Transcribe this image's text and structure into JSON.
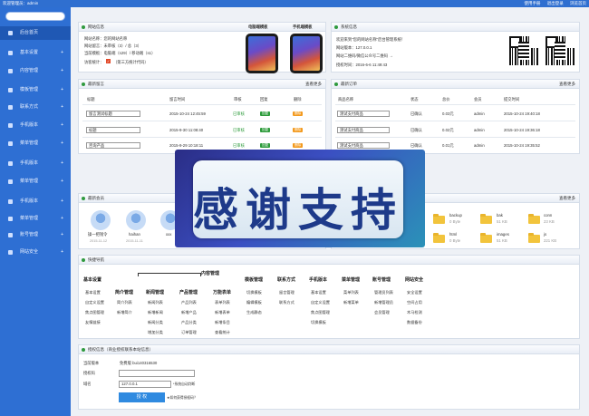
{
  "topbar": {
    "title": "欢迎管理员：admin",
    "links": [
      "使用手册",
      "退出登录",
      "浏览首页"
    ]
  },
  "sidebar": {
    "items": [
      {
        "label": "后台首页",
        "plus": ""
      },
      {
        "label": "基本设置",
        "plus": "+"
      },
      {
        "label": "内容管理",
        "plus": "+"
      },
      {
        "label": "模板管理",
        "plus": "+"
      },
      {
        "label": "联系方式",
        "plus": "+"
      },
      {
        "label": "手机版本",
        "plus": "+"
      },
      {
        "label": "菜单管理",
        "plus": "+"
      },
      {
        "label": "手机版本",
        "plus": "+"
      },
      {
        "label": "菜单管理",
        "plus": "+"
      },
      {
        "label": "手机版本",
        "plus": "+"
      },
      {
        "label": "菜单管理",
        "plus": "+"
      },
      {
        "label": "账号管理",
        "plus": "+"
      },
      {
        "label": "网站安全",
        "plus": "+"
      }
    ]
  },
  "site_info": {
    "title": "网站信息",
    "lines": [
      "网站名称：您的网站名称",
      "网站留言：未审核（3）/ 总（3）",
      "当前模板：电脑端（s29）/ 移动端（s1）",
      "访客统计：",
      "（第三方统计代码）"
    ],
    "pc_label": "电脑端模板",
    "mobile_label": "手机端模板",
    "ok": "✓"
  },
  "sys_info": {
    "title": "系统信息",
    "lines": [
      "欢迎来到\"您的网站名称\"后台管理系统！",
      "网站版本：127.0.0.1",
      "网站二维码/微信公众号二维码 →",
      "授权时间：2016-6-6 11:49:43"
    ]
  },
  "messages": {
    "title": "最新留言",
    "more": "查看更多",
    "headers": [
      "标题",
      "留言时间",
      "审核",
      "回复",
      "删除"
    ],
    "rows": [
      {
        "title": "留言测试标题",
        "time": "2015-10-24 12:45:59",
        "status": "已审核",
        "reply": "回复",
        "del": "删除"
      },
      {
        "title": "标题",
        "time": "2015-9-30 11:08:40",
        "status": "已审核",
        "reply": "回复",
        "del": "删除"
      },
      {
        "title": "咨询产品",
        "time": "2015-9-29 10:18:11",
        "status": "已审核",
        "reply": "回复",
        "del": "删除"
      }
    ]
  },
  "orders": {
    "title": "最新订单",
    "more": "查看更多",
    "headers": [
      "商品名称",
      "状态",
      "总价",
      "会员",
      "提交时间"
    ],
    "rows": [
      {
        "name": "测试支付商品",
        "status": "已确认",
        "price": "0.03元",
        "member": "admin",
        "time": "2015-10-24 19:40:18"
      },
      {
        "name": "测试支付商品",
        "status": "已确认",
        "price": "0.02元",
        "member": "admin",
        "time": "2015-10-24 19:36:18"
      },
      {
        "name": "测试支付商品",
        "status": "已确认",
        "price": "0.01元",
        "member": "admin",
        "time": "2015-10-24 19:35:52"
      }
    ]
  },
  "members": {
    "title": "最新会员",
    "more": "查看更多",
    "list": [
      {
        "name": "操一把钱令",
        "date": "2015-11-12"
      },
      {
        "name": "haihan",
        "date": "2015-11-11"
      },
      {
        "name": "xxx",
        "date": ""
      }
    ]
  },
  "files": {
    "more": "查看更多",
    "list": [
      {
        "name": "backup",
        "size": "0 Byte"
      },
      {
        "name": "bak",
        "size": "51 KB"
      },
      {
        "name": "conn",
        "size": "23 KB"
      },
      {
        "name": "html",
        "size": "0 Byte"
      },
      {
        "name": "images",
        "size": "51 KB"
      },
      {
        "name": "js",
        "size": "221 KB"
      }
    ]
  },
  "nav": {
    "title": "快捷导航",
    "content_mgmt": "内容管理",
    "groups": [
      {
        "title": "基本设置",
        "items": [
          "基本设置",
          "自定义设置",
          "焦点图管理",
          "友情链接"
        ]
      },
      {
        "title": "简介管理",
        "items": [
          "简介列表",
          "新增简介"
        ]
      },
      {
        "title": "新闻管理",
        "items": [
          "新闻列表",
          "新增新闻",
          "新闻分类",
          "增加分类"
        ]
      },
      {
        "title": "产品管理",
        "items": [
          "产品列表",
          "新增产品",
          "产品分类",
          "订单管理"
        ]
      },
      {
        "title": "万能表单",
        "items": [
          "表单列表",
          "新增表单",
          "新增条目",
          "查看统计"
        ]
      },
      {
        "title": "模板管理",
        "items": [
          "切换模板",
          "编辑模板",
          "生成静态"
        ]
      },
      {
        "title": "联系方式",
        "items": [
          "留言管理",
          "联系方式"
        ]
      },
      {
        "title": "手机版本",
        "items": [
          "基本设置",
          "自定义设置",
          "焦点图管理",
          "切换模板"
        ]
      },
      {
        "title": "菜单管理",
        "items": [
          "菜单列表",
          "新增菜单"
        ]
      },
      {
        "title": "账号管理",
        "items": [
          "管理员列表",
          "新增管理员",
          "会员管理"
        ]
      },
      {
        "title": "网站安全",
        "items": [
          "安全设置",
          "空间占用",
          "木马检测",
          "数据备份"
        ]
      }
    ]
  },
  "license": {
    "title": "授权信息（商业授权联系本站信息）",
    "ver_label": "当前版本",
    "ver_value": "免费版 bui140316530",
    "code_label": "授权码",
    "domain_label": "域名",
    "domain_value": "127.0.0.1",
    "domain_note": "*系统自动判断",
    "submit": "授 权",
    "help": "★如何获得授权码？"
  },
  "overlay": {
    "text": "感谢支持"
  }
}
